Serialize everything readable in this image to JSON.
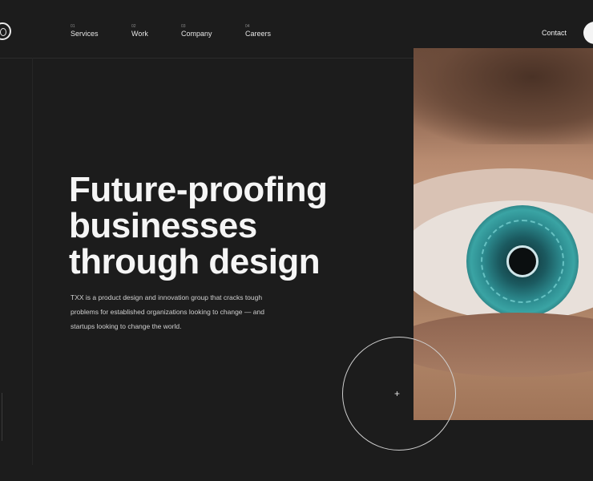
{
  "nav": {
    "items": [
      {
        "num": "01",
        "label": "Services"
      },
      {
        "num": "02",
        "label": "Work"
      },
      {
        "num": "03",
        "label": "Company"
      },
      {
        "num": "04",
        "label": "Careers"
      }
    ],
    "contact_label": "Contact"
  },
  "hero": {
    "title": "Future-proofing businesses through design",
    "description": "TXX is a product design and innovation group that cracks tough problems for established organizations looking to change — and startups looking to change the world."
  },
  "icons": {
    "logo": "logo-mark-icon",
    "plus": "plus-icon",
    "theme_toggle": "toggle-icon"
  },
  "colors": {
    "background": "#1c1c1c",
    "text": "#f5f5f5"
  }
}
